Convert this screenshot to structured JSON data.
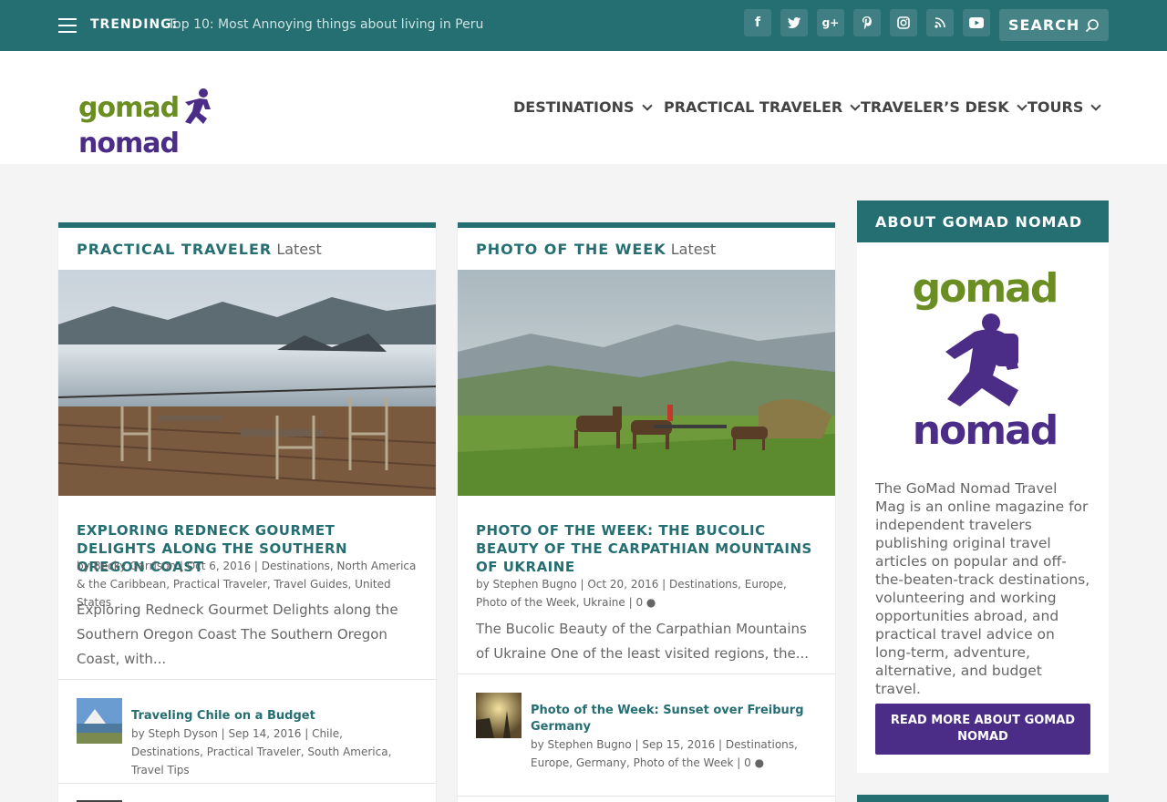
{
  "topbar": {
    "trending_label": "TRENDING:",
    "trending_link": "Top 10: Most Annoying things about living in Peru",
    "search_placeholder": "SEARCH",
    "social": [
      "f",
      "t",
      "g+",
      "p",
      "ig",
      "rss",
      "yt"
    ]
  },
  "logo": {
    "part1": "gomad",
    "part2": "nomad"
  },
  "nav": {
    "items": [
      {
        "label": "DESTINATIONS"
      },
      {
        "label": "PRACTICAL TRAVELER"
      },
      {
        "label": "TRAVELER’S DESK"
      },
      {
        "label": "TOURS"
      }
    ]
  },
  "cards": [
    {
      "heading_strong": "PRACTICAL TRAVELER",
      "heading_light": "Latest",
      "post_title": "EXPLORING REDNECK GOURMET DELIGHTS ALONG THE SOUTHERN OREGON COAST",
      "author": "Becky Garrison",
      "date": "Oct 6, 2016",
      "categories": "Destinations, North America & the Caribbean, Practical Traveler, Travel Guides, United States",
      "excerpt": "Exploring Redneck Gourmet Delights along the Southern Oregon Coast The Southern Oregon Coast, with...",
      "sub_title": "Traveling Chile on a Budget",
      "sub_author": "Steph Dyson",
      "sub_date": "Sep 14, 2016",
      "sub_categories": "Chile, Destinations, Practical Traveler, South America, Travel Tips"
    },
    {
      "heading_strong": "PHOTO OF THE WEEK",
      "heading_light": "Latest",
      "post_title": "PHOTO OF THE WEEK: THE BUCOLIC BEAUTY OF THE CARPATHIAN MOUNTAINS OF UKRAINE",
      "author": "Stephen Bugno",
      "date": "Oct 20, 2016",
      "categories": "Destinations, Europe, Photo of the Week, Ukraine",
      "comments": "0",
      "excerpt": "The Bucolic Beauty of the Carpathian Mountains of Ukraine One of the least visited regions, the...",
      "sub_title": "Photo of the Week: Sunset over Freiburg Germany",
      "sub_author": "Stephen Bugno",
      "sub_date": "Sep 15, 2016",
      "sub_categories": "Destinations, Europe, Germany, Photo of the Week",
      "sub_comments": "0"
    }
  ],
  "sidebar": {
    "heading": "ABOUT GOMAD NOMAD",
    "logo_part1": "gomad",
    "logo_part2": "nomad",
    "text": "The GoMad Nomad Travel Mag is an online magazine for independent travelers publishing original travel articles on popular and off-the-beaten-track destinations, volunteering and working opportunities abroad, and practical travel advice on long-term, adventure, alternative, and budget travel.",
    "button": "READ MORE ABOUT GOMAD NOMAD"
  },
  "colors": {
    "teal": "#256e72",
    "purple": "#4b2c86",
    "green": "#6b8e23"
  }
}
